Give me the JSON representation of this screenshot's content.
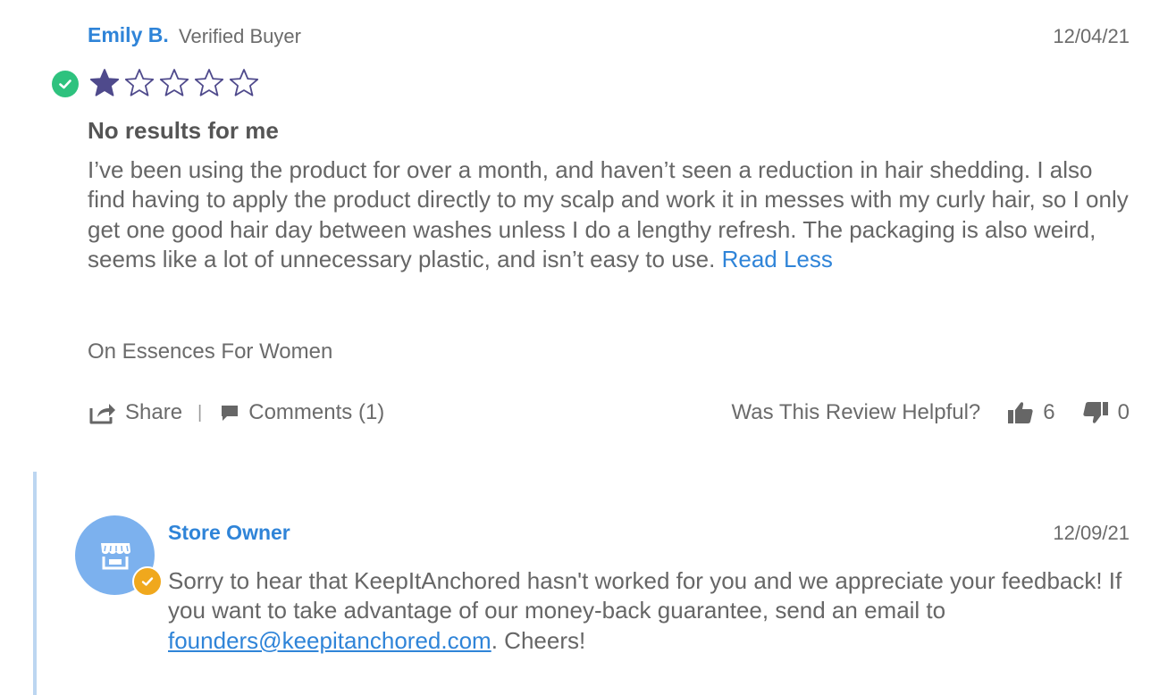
{
  "review": {
    "author": "Emily B.",
    "author_badge": "Verified Buyer",
    "date": "12/04/21",
    "rating": 1,
    "max_rating": 5,
    "title": "No results for me",
    "body": "I’ve been using the product for over a month, and haven’t seen a reduction in hair shedding. I also find having to apply the product directly to my scalp and work it in messes with my curly hair, so I only get one good hair day between washes unless I do a lengthy refresh. The packaging is also weird, seems like a lot of unnecessary plastic, and isn’t easy to use.",
    "read_less_label": "Read Less",
    "product_line": "On Essences For Women",
    "share_label": "Share",
    "separator": "|",
    "comments_label": "Comments (1)",
    "helpful_prompt": "Was This Review Helpful?",
    "thumbs_up_count": "6",
    "thumbs_down_count": "0"
  },
  "owner_reply": {
    "name": "Store Owner",
    "date": "12/09/21",
    "text_before": "Sorry to hear that KeepItAnchored hasn't worked for you and we appreciate your feedback! If you want to take advantage of our money-back guarantee, send an email to ",
    "email": "founders@keepitanchored.com",
    "text_after": ". Cheers!"
  },
  "icons": {
    "verified": "check-circle-icon",
    "star": "star-icon",
    "share": "share-icon",
    "comments": "comment-icon",
    "thumbs_up": "thumbs-up-icon",
    "thumbs_down": "thumbs-down-icon",
    "store": "storefront-icon",
    "owner_check": "check-badge-icon"
  },
  "colors": {
    "link": "#2f84d8",
    "star_filled": "#4f4a8c",
    "verified_green": "#2ec27e",
    "avatar_blue": "#7cb1ee",
    "owner_check": "#f0a81d",
    "reply_rule": "#bcd6f1"
  }
}
